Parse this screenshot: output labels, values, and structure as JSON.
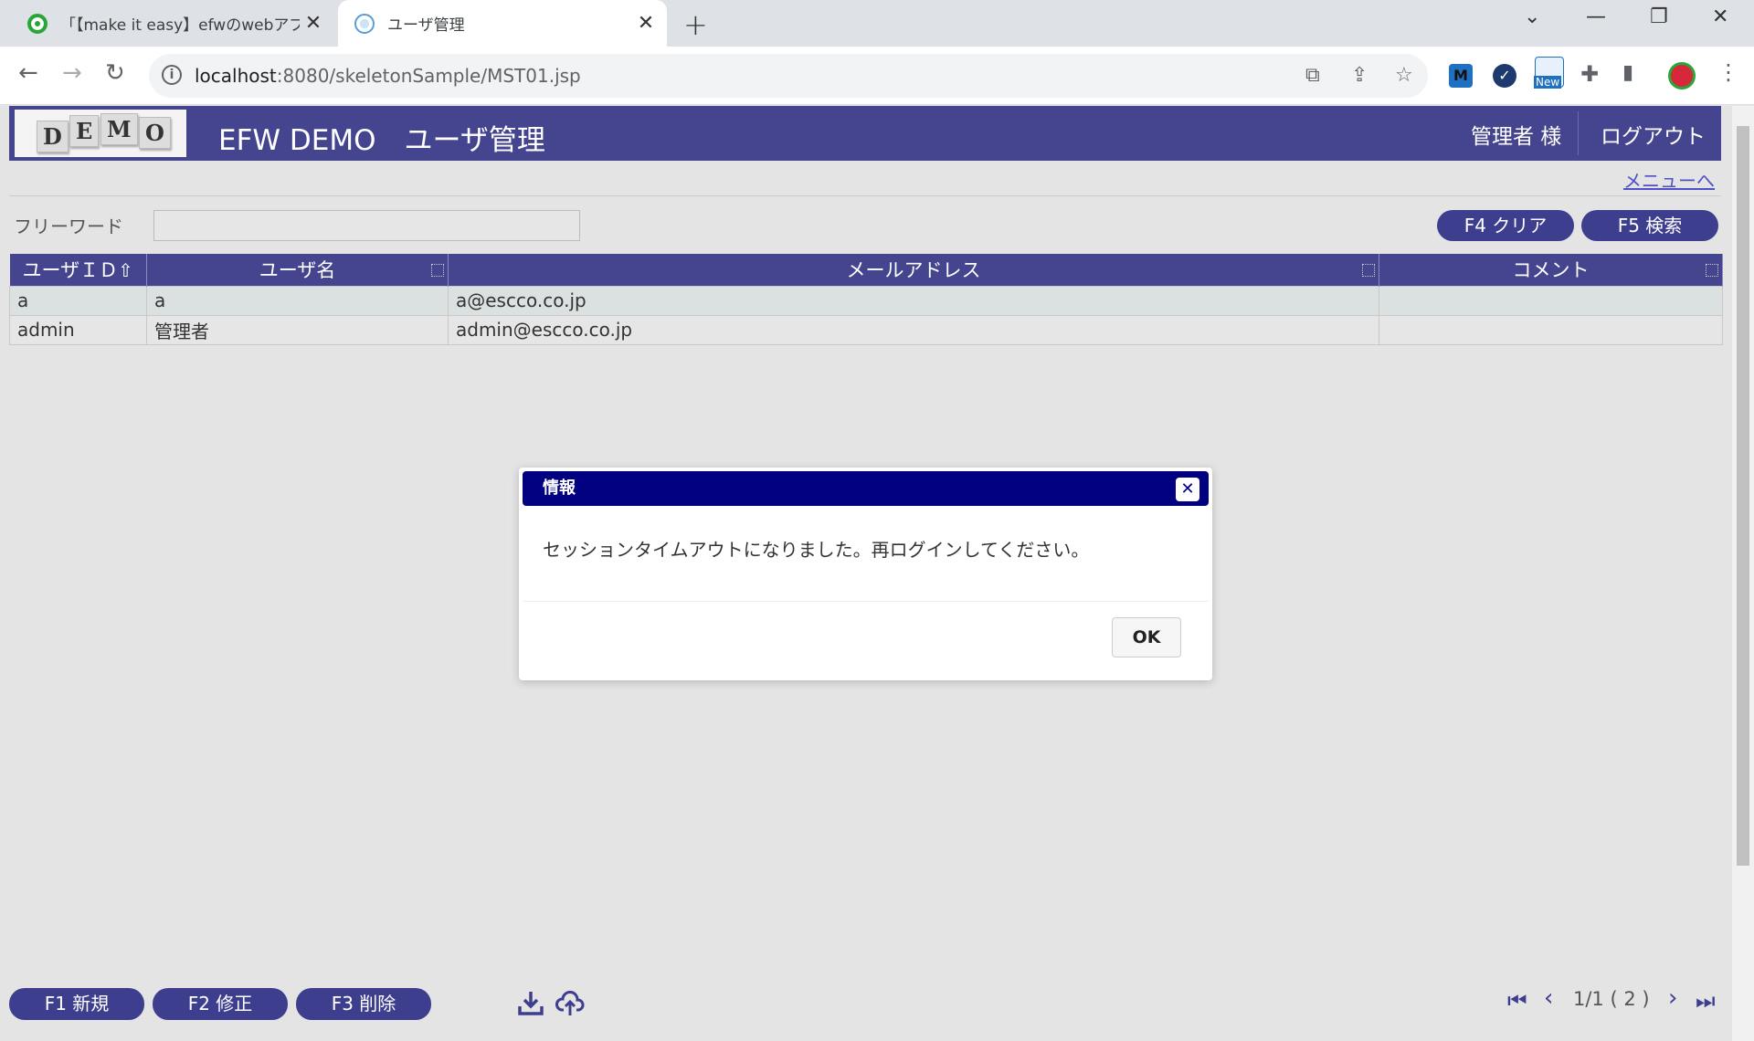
{
  "browser": {
    "tabs": [
      {
        "title": "「【make it easy】efwのwebアプリの",
        "active": false
      },
      {
        "title": "ユーザ管理",
        "active": true
      }
    ],
    "url_host": "localhost",
    "url_path": ":8080/skeletonSample/MST01.jsp",
    "new_badge": "New",
    "ext_letter": "M"
  },
  "app": {
    "logo_letters": [
      "D",
      "E",
      "M",
      "O"
    ],
    "title": "EFW DEMO　ユーザ管理",
    "user_label": "管理者 様",
    "logout_label": "ログアウト",
    "menu_link": "メニューへ",
    "freeword_label": "フリーワード",
    "freeword_value": "",
    "clear_button": "F4 クリア",
    "search_button": "F5 検索",
    "colors": {
      "header": "#45458f",
      "button": "#3e3e8e",
      "modal_title": "#000080"
    }
  },
  "table": {
    "columns": [
      "ユーザＩＤ",
      "ユーザ名",
      "メールアドレス",
      "コメント"
    ],
    "rows": [
      [
        "a",
        "a",
        "a@escco.co.jp",
        ""
      ],
      [
        "admin",
        "管理者",
        "admin@escco.co.jp",
        ""
      ]
    ]
  },
  "footer": {
    "new_button": "F1 新規",
    "edit_button": "F2 修正",
    "delete_button": "F3 削除",
    "page_info": "1/1 ( 2 )"
  },
  "modal": {
    "title": "情報",
    "message": "セッションタイムアウトになりました。再ログインしてください。",
    "ok_button": "OK"
  }
}
